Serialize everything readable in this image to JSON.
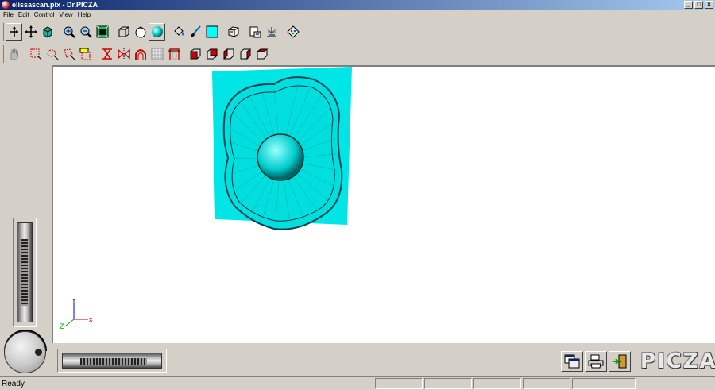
{
  "window": {
    "title": "elissascan.pix - Dr.PICZA"
  },
  "window_buttons": {
    "minimize": "_",
    "maximize": "□",
    "close": "×"
  },
  "menu": [
    {
      "label": "File"
    },
    {
      "label": "Edit"
    },
    {
      "label": "Control"
    },
    {
      "label": "View"
    },
    {
      "label": "Help"
    }
  ],
  "toolbar1_icons": [
    "select-arrow-icon",
    "move-cross-icon",
    "rotate-cube-icon",
    "zoom-in-icon",
    "zoom-out-icon",
    "zoom-fit-icon",
    "wireframe-icon",
    "shaded-surface-icon",
    "sphere-render-icon",
    "paint-bucket-icon",
    "brush-icon",
    "color-swatch-icon",
    "cube-view-icon",
    "export-icon",
    "scan-icon",
    "settings-icon"
  ],
  "toolbar2_icons": [
    "hand-icon",
    "rect-select-icon",
    "lasso-select-icon",
    "erase-select-icon",
    "select-all-icon",
    "mirror-x-icon",
    "mirror-y-icon",
    "arch-icon",
    "grid-icon",
    "crop-icon",
    "view-front-icon",
    "view-back-icon",
    "view-left-icon",
    "view-right-icon",
    "view-top-icon"
  ],
  "viewport": {
    "axes": {
      "y": "Y",
      "x": "x",
      "z": "Z"
    },
    "model_color": "#00e5e5"
  },
  "bottom": {
    "logo_text": "PICZA"
  },
  "status": {
    "text": "Ready"
  }
}
